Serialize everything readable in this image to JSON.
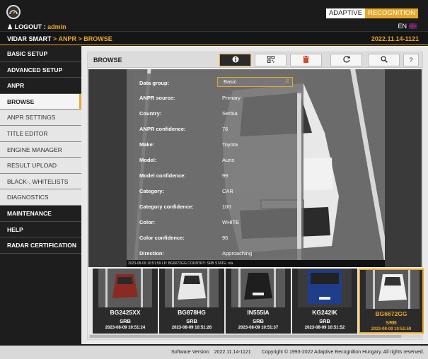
{
  "header": {
    "logout_label": "LOGOUT",
    "separator": ":",
    "username": "admin",
    "brand_part1": "ADAPTIVE",
    "brand_part2": "RECOGNITION",
    "language": "EN"
  },
  "breadcrumb": {
    "root": "VIDAR SMART",
    "path": "> ANPR > BROWSE",
    "version": "2022.11.14-1121"
  },
  "sidebar": {
    "items": [
      {
        "label": "BASIC SETUP"
      },
      {
        "label": "ADVANCED SETUP"
      },
      {
        "label": "ANPR"
      },
      {
        "label": "BROWSE"
      },
      {
        "label": "ANPR SETTINGS"
      },
      {
        "label": "TITLE EDITOR"
      },
      {
        "label": "ENGINE MANAGER"
      },
      {
        "label": "RESULT UPLOAD"
      },
      {
        "label": "BLACK-, WHITELISTS"
      },
      {
        "label": "DIAGNOSTICS"
      },
      {
        "label": "MAINTENANCE"
      },
      {
        "label": "HELP"
      },
      {
        "label": "RADAR CERTIFICATION"
      }
    ]
  },
  "panel": {
    "title": "BROWSE",
    "toolbar": {
      "info_icon": "info-icon",
      "qr_icon": "qr-code-icon",
      "delete_icon": "trash-icon",
      "refresh_icon": "refresh-icon",
      "search_icon": "search-icon",
      "help_label": "?"
    }
  },
  "details": {
    "data_group_label": "Data group:",
    "data_group_value": "Basic",
    "rows": [
      {
        "key": "ANPR source:",
        "value": "Primary"
      },
      {
        "key": "Country:",
        "value": "Serbia"
      },
      {
        "key": "ANPR confidence:",
        "value": "76"
      },
      {
        "key": "Make:",
        "value": "Toyota"
      },
      {
        "key": "Model:",
        "value": "Auris"
      },
      {
        "key": "Model confidence:",
        "value": "99"
      },
      {
        "key": "Category:",
        "value": "CAR"
      },
      {
        "key": "Category confidence:",
        "value": "100"
      },
      {
        "key": "Color:",
        "value": "WHITE"
      },
      {
        "key": "Color confidence:",
        "value": "95"
      },
      {
        "key": "Direction:",
        "value": "Approaching"
      }
    ]
  },
  "image_caption": "2023-08-09 10:51:59 LP: BG6672GG COUNTRY: SRB STATE: n/a",
  "thumbnails": [
    {
      "plate": "BG2425XX",
      "country": "SRB",
      "time": "2023-08-09 10:51:24",
      "car_color": "#8a2a22",
      "selected": false
    },
    {
      "plate": "BG878HG",
      "country": "SRB",
      "time": "2023-08-09 10:51:26",
      "car_color": "#e8e8e8",
      "selected": false
    },
    {
      "plate": "IN555IA",
      "country": "SRB",
      "time": "2023-08-09 10:51:37",
      "car_color": "#1e1e1e",
      "selected": false
    },
    {
      "plate": "KG242IK",
      "country": "SRB",
      "time": "2023-08-09 10:51:52",
      "car_color": "#1f3d8a",
      "selected": false
    },
    {
      "plate": "BG6672GG",
      "country": "SRB",
      "time": "2023-08-09 10:51:59",
      "car_color": "#f0f0f0",
      "selected": true
    }
  ],
  "footer": {
    "software_version_label": "Software Version:",
    "software_version": "2022.11.14-1121",
    "copyright": "Copyright © 1993-2022 Adaptive Recognition Hungary. All rights reserved."
  },
  "colors": {
    "accent": "#e8a72a",
    "dark": "#1d1d1d"
  }
}
